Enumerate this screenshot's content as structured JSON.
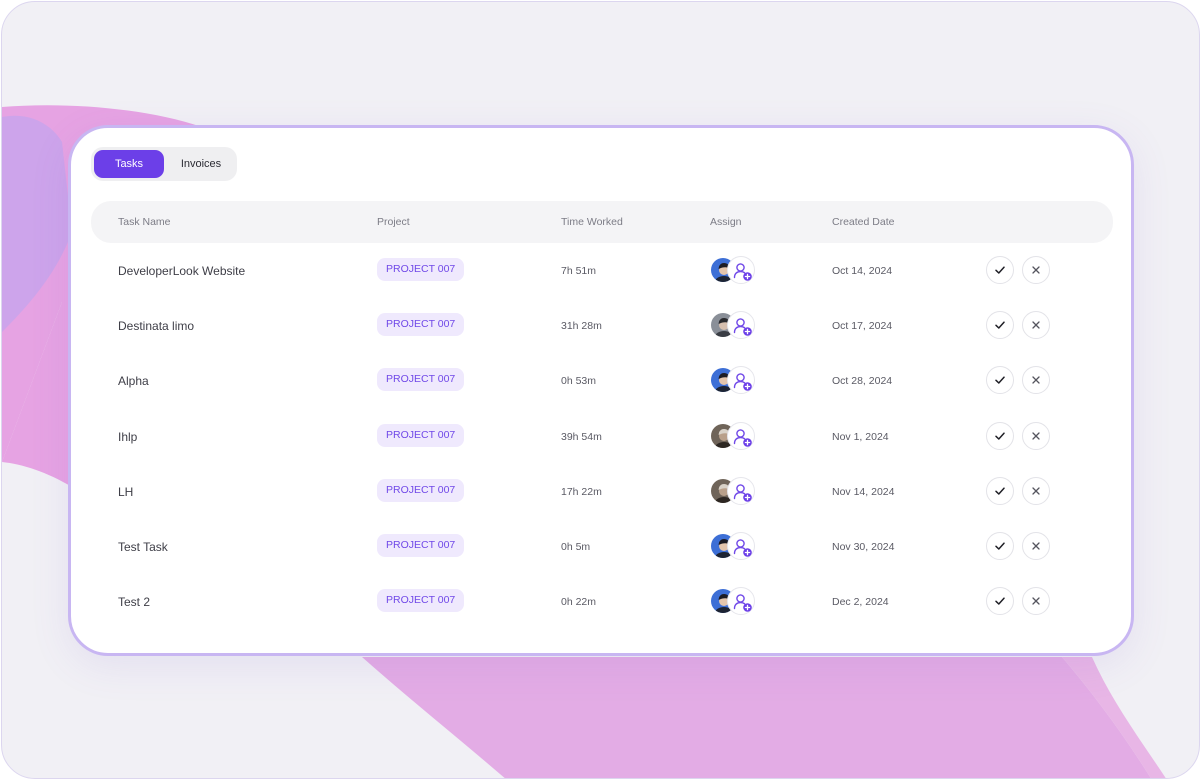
{
  "tabs": [
    {
      "label": "Tasks",
      "active": true
    },
    {
      "label": "Invoices",
      "active": false
    }
  ],
  "columns": {
    "task_name": "Task Name",
    "project": "Project",
    "time_worked": "Time Worked",
    "assign": "Assign",
    "created_date": "Created Date"
  },
  "colors": {
    "accent": "#6c3fe8",
    "badge_bg": "#efe9fd",
    "badge_text": "#7048e8",
    "card_border": "#c8b6f2",
    "decor_pink": "#e6a3e3",
    "decor_lavender": "#c8a5ec"
  },
  "icons": {
    "approve": "check-icon",
    "reject": "close-icon",
    "assign": "add-user-icon"
  },
  "rows": [
    {
      "task": "DeveloperLook Website",
      "project": "PROJECT 007",
      "time": "7h 51m",
      "date": "Oct 14, 2024",
      "avatar": "blue"
    },
    {
      "task": "Destinata limo",
      "project": "PROJECT 007",
      "time": "31h 28m",
      "date": "Oct 17, 2024",
      "avatar": "grey"
    },
    {
      "task": "Alpha",
      "project": "PROJECT 007",
      "time": "0h 53m",
      "date": "Oct 28, 2024",
      "avatar": "blue"
    },
    {
      "task": "Ihlp",
      "project": "PROJECT 007",
      "time": "39h 54m",
      "date": "Nov 1, 2024",
      "avatar": "sepia"
    },
    {
      "task": "LH",
      "project": "PROJECT 007",
      "time": "17h 22m",
      "date": "Nov 14, 2024",
      "avatar": "sepia"
    },
    {
      "task": "Test Task",
      "project": "PROJECT 007",
      "time": "0h 5m",
      "date": "Nov 30, 2024",
      "avatar": "blue"
    },
    {
      "task": "Test 2",
      "project": "PROJECT 007",
      "time": "0h 22m",
      "date": "Dec 2, 2024",
      "avatar": "blue"
    }
  ]
}
